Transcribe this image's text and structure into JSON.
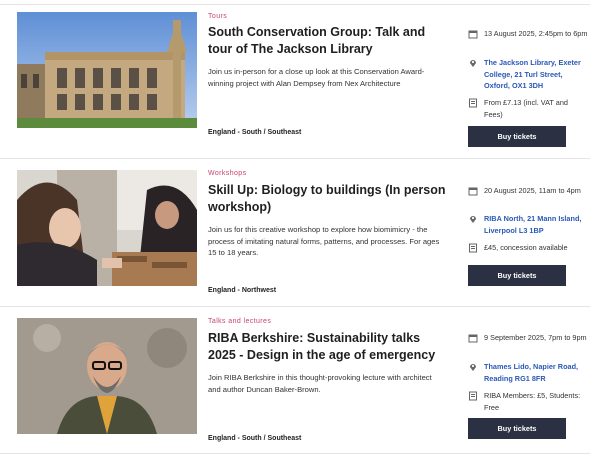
{
  "events": [
    {
      "category": "Tours",
      "title": "South Conservation Group: Talk and tour of The Jackson Library",
      "description": "Join us in-person for a close up look at this Conservation Award-winning project with Alan Dempsey from Nex Architecture",
      "region": "England - South / Southeast",
      "date": "13 August 2025, 2:45pm to 6pm",
      "location": "The Jackson Library, Exeter College, 21 Turl Street, Oxford, OX1 3DH",
      "price": "From £7.13 (incl. VAT and Fees)",
      "button": "Buy tickets"
    },
    {
      "category": "Workshops",
      "title": "Skill Up: Biology to buildings (In person workshop)",
      "description": "Join us for this creative workshop to explore how biomimicry - the process of imitating natural forms, patterns, and processes. For ages 15 to 18 years.",
      "region": "England - Northwest",
      "date": "20 August 2025, 11am to 4pm",
      "location": "RIBA North, 21 Mann Island, Liverpool L3 1BP",
      "price": "£45, concession available",
      "button": "Buy tickets"
    },
    {
      "category": "Talks and lectures",
      "title": "RIBA Berkshire: Sustainability talks 2025 - Design in the age of emergency",
      "description": "Join RIBA Berkshire in this thought-provoking lecture with architect and author Duncan Baker-Brown.",
      "region": "England - South / Southeast",
      "date": "9 September 2025, 7pm to 9pm",
      "location": "Thames Lido, Napier Road, Reading RG1 8FR",
      "price": "RIBA Members: £5, Students: Free",
      "button": "Buy tickets"
    }
  ],
  "icons": {
    "date": "calendar-icon",
    "location": "map-pin-icon",
    "price": "ticket-icon"
  },
  "colors": {
    "category": "#c8456a",
    "link": "#2a59b8",
    "button": "#2b3142"
  }
}
